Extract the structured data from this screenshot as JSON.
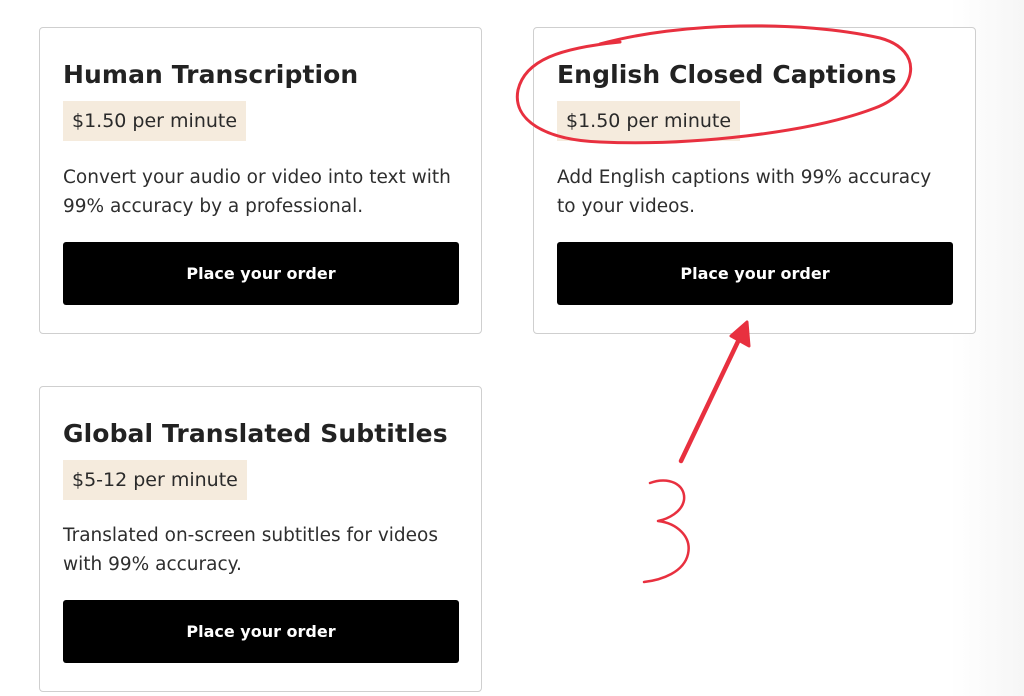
{
  "cards": [
    {
      "title": "Human Transcription",
      "price": "$1.50 per minute",
      "description": "Convert your audio or video into text with 99% accuracy by a professional.",
      "button_label": "Place your order"
    },
    {
      "title": "English Closed Captions",
      "price": "$1.50 per minute",
      "description": "Add English captions with 99% accuracy to your videos.",
      "button_label": "Place your order"
    },
    {
      "title": "Global Translated Subtitles",
      "price": "$5-12 per minute",
      "description": "Translated on-screen subtitles for videos with 99% accuracy.",
      "button_label": "Place your order"
    }
  ],
  "annotation": {
    "color": "#e8303f",
    "number_label": "3"
  },
  "colors": {
    "price_badge_bg": "#f5ebdd",
    "button_bg": "#000000",
    "card_border": "#cfcfcf"
  }
}
